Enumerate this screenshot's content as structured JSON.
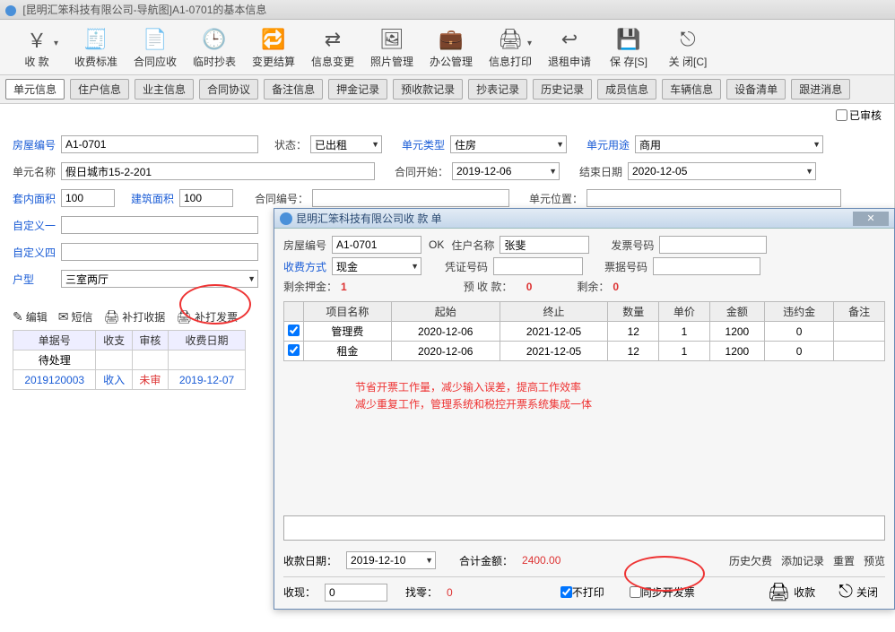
{
  "window_title": "[昆明汇笨科技有限公司-导航图]A1-0701的基本信息",
  "toolbar": [
    {
      "key": "collect",
      "label": "收  款"
    },
    {
      "key": "fee-std",
      "label": "收费标准"
    },
    {
      "key": "contract-ar",
      "label": "合同应收"
    },
    {
      "key": "temp-meter",
      "label": "临时抄表"
    },
    {
      "key": "change-settle",
      "label": "变更结算"
    },
    {
      "key": "info-change",
      "label": "信息变更"
    },
    {
      "key": "photo-mgr",
      "label": "照片管理"
    },
    {
      "key": "office-mgr",
      "label": "办公管理"
    },
    {
      "key": "info-print",
      "label": "信息打印"
    },
    {
      "key": "refund-apply",
      "label": "退租申请"
    },
    {
      "key": "save",
      "label": "保 存[S]"
    },
    {
      "key": "close",
      "label": "关 闭[C]"
    }
  ],
  "tabs": [
    "单元信息",
    "住户信息",
    "业主信息",
    "合同协议",
    "备注信息",
    "押金记录",
    "预收款记录",
    "抄表记录",
    "历史记录",
    "成员信息",
    "车辆信息",
    "设备清单",
    "跟进消息"
  ],
  "audited_label": "已审核",
  "form": {
    "house_no_lbl": "房屋编号",
    "house_no": "A1-0701",
    "state_lbl": "状态：",
    "state": "已出租",
    "unit_type_lbl": "单元类型",
    "unit_type": "住房",
    "unit_use_lbl": "单元用途",
    "unit_use": "商用",
    "unit_name_lbl": "单元名称",
    "unit_name": "假日城市15-2-201",
    "contract_start_lbl": "合同开始：",
    "contract_start": "2019-12-06",
    "end_date_lbl": "结束日期",
    "end_date": "2020-12-05",
    "inside_area_lbl": "套内面积",
    "inside_area": "100",
    "build_area_lbl": "建筑面积",
    "build_area": "100",
    "contract_no_lbl": "合同编号：",
    "contract_no": "",
    "unit_pos_lbl": "单元位置：",
    "unit_pos": "",
    "cust1_lbl": "自定义一",
    "cust1": "",
    "cust4_lbl": "自定义四",
    "cust4": "",
    "hx_lbl": "户型",
    "hx": "三室两厅"
  },
  "actions": {
    "edit": "编辑",
    "sms": "短信",
    "reprint_receipt": "补打收据",
    "reprint_invoice": "补打发票"
  },
  "small_table": {
    "headers": [
      "单据号",
      "收支",
      "审核",
      "收费日期"
    ],
    "pending": "待处理",
    "row": [
      "2019120003",
      "收入",
      "未审",
      "2019-12-07"
    ]
  },
  "dialog": {
    "title": "昆明汇笨科技有限公司收  款  单",
    "house_no_lbl": "房屋编号",
    "house_no": "A1-0701",
    "ok": "OK",
    "resident_lbl": "住户名称",
    "resident": "张斐",
    "invoice_no_lbl": "发票号码",
    "invoice_no": "",
    "pay_method_lbl": "收费方式",
    "pay_method": "现金",
    "voucher_lbl": "凭证号码",
    "voucher": "",
    "ticket_no_lbl": "票据号码",
    "ticket_no": "",
    "deposit_rem_lbl": "剩余押金：",
    "deposit_rem": "1",
    "pre_rec_lbl": "预 收  款：",
    "pre_rec": "0",
    "remain_lbl": "剩余：",
    "remain": "0",
    "headers": [
      "",
      "项目名称",
      "起始",
      "终止",
      "数量",
      "单价",
      "金额",
      "违约金",
      "备注"
    ],
    "rows": [
      {
        "chk": true,
        "name": "管理费",
        "start": "2020-12-06",
        "end": "2021-12-05",
        "qty": "12",
        "price": "1",
        "amt": "1200",
        "penalty": "0",
        "remark": ""
      },
      {
        "chk": true,
        "name": "租金",
        "start": "2020-12-06",
        "end": "2021-12-05",
        "qty": "12",
        "price": "1",
        "amt": "1200",
        "penalty": "0",
        "remark": ""
      }
    ],
    "promo_line1": "节省开票工作量，减少输入误差，提高工作效率",
    "promo_line2": "减少重复工作，管理系统和税控开票系统集成一体",
    "rec_date_lbl": "收款日期：",
    "rec_date": "2019-12-10",
    "total_lbl": "合计金额：",
    "total": "2400.00",
    "hist_debt": "历史欠费",
    "add_rec": "添加记录",
    "reset": "重置",
    "preview": "预览",
    "received_lbl": "收现：",
    "received": "0",
    "change_lbl": "找零：",
    "change": "0",
    "no_print": "不打印",
    "sync_invoice": "同步开发票",
    "collect_btn": "收款",
    "close_btn": "关闭"
  }
}
